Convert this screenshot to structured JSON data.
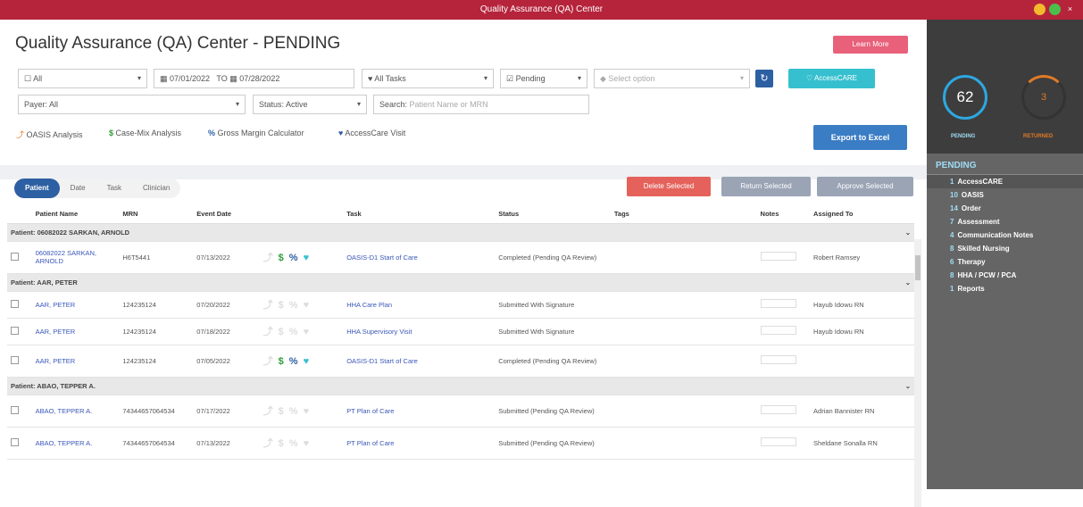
{
  "window": {
    "title": "Quality Assurance (QA) Center"
  },
  "page": {
    "title": "Quality Assurance (QA) Center - PENDING",
    "learn_more": "Learn More"
  },
  "filters": {
    "scope": "All",
    "date_from": "07/01/2022",
    "to": "TO",
    "date_to": "07/28/2022",
    "tasks": "All Tasks",
    "status_filter": "Pending",
    "select_placeholder": "Select option",
    "accesscare": "AccessCARE",
    "payer_label": "Payer:",
    "payer": "All",
    "status_label": "Status:",
    "status": "Active",
    "search_label": "Search:",
    "search_placeholder": "Patient Name or MRN"
  },
  "links": {
    "oasis": "OASIS Analysis",
    "casemix": "Case-Mix Analysis",
    "margin": "Gross Margin Calculator",
    "visit": "AccessCare Visit"
  },
  "actions": {
    "export": "Export to Excel",
    "delete": "Delete Selected",
    "return": "Return Selected",
    "approve": "Approve Selected"
  },
  "tabs": [
    "Patient",
    "Date",
    "Task",
    "Clinician"
  ],
  "columns": [
    "Patient Name",
    "MRN",
    "Event Date",
    "Task",
    "Status",
    "Tags",
    "Notes",
    "Assigned To"
  ],
  "groups": [
    {
      "label": "Patient: 06082022 SARKAN, ARNOLD",
      "rows": [
        {
          "name": "06082022 SARKAN, ARNOLD",
          "mrn": "H6T5441",
          "date": "07/13/2022",
          "task": "OASIS-D1 Start of Care",
          "status": "Completed (Pending QA Review)",
          "assigned": "Robert Ramsey",
          "active": true
        }
      ]
    },
    {
      "label": "Patient: AAR, PETER",
      "rows": [
        {
          "name": "AAR, PETER",
          "mrn": "124235124",
          "date": "07/20/2022",
          "task": "HHA Care Plan",
          "status": "Submitted With Signature",
          "assigned": "Hayub Idowu RN",
          "active": false
        },
        {
          "name": "AAR, PETER",
          "mrn": "124235124",
          "date": "07/18/2022",
          "task": "HHA Supervisory Visit",
          "status": "Submitted With Signature",
          "assigned": "Hayub Idowu RN",
          "active": false
        },
        {
          "name": "AAR, PETER",
          "mrn": "124235124",
          "date": "07/05/2022",
          "task": "OASIS-D1 Start of Care",
          "status": "Completed (Pending QA Review)",
          "assigned": "",
          "active": true
        }
      ]
    },
    {
      "label": "Patient: ABAO, TEPPER A.",
      "rows": [
        {
          "name": "ABAO, TEPPER A.",
          "mrn": "74344657064534",
          "date": "07/17/2022",
          "task": "PT Plan of Care",
          "status": "Submitted (Pending QA Review)",
          "assigned": "Adrian Bannister RN",
          "active": false
        },
        {
          "name": "ABAO, TEPPER A.",
          "mrn": "74344657064534",
          "date": "07/13/2022",
          "task": "PT Plan of Care",
          "status": "Submitted (Pending QA Review)",
          "assigned": "Sheldane Sonalla RN",
          "active": false
        }
      ]
    }
  ],
  "sidebar": {
    "pending_count": "62",
    "pending_label": "PENDING",
    "returned_count": "3",
    "returned_label": "RETURNED",
    "heading": "PENDING",
    "items": [
      {
        "n": "1",
        "label": "AccessCARE"
      },
      {
        "n": "10",
        "label": "OASIS"
      },
      {
        "n": "14",
        "label": "Order"
      },
      {
        "n": "7",
        "label": "Assessment"
      },
      {
        "n": "4",
        "label": "Communication Notes"
      },
      {
        "n": "8",
        "label": "Skilled Nursing"
      },
      {
        "n": "6",
        "label": "Therapy"
      },
      {
        "n": "8",
        "label": "HHA / PCW / PCA"
      },
      {
        "n": "1",
        "label": "Reports"
      }
    ]
  }
}
